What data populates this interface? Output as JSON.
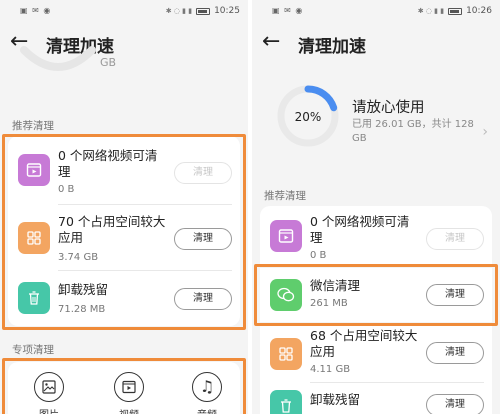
{
  "colors": {
    "accent": "#4a8df0",
    "highlight": "#ef8b3a",
    "purple": "#c77ad6",
    "orange_tile": "#f3a561",
    "teal": "#46c7a8",
    "green": "#5fcd6d"
  },
  "left": {
    "status": {
      "icons": "▣ ✉ ◉",
      "time": "10:25",
      "right_icons": "✱ ◌ ▮ ▮"
    },
    "title": "清理加速",
    "gb_partial": "GB",
    "section_recommend": "推荐清理",
    "items": [
      {
        "title_line1": "0 个网络视频可清",
        "title_line2": "理",
        "sub": "0 B",
        "button": "清理",
        "icon": "video-icon"
      },
      {
        "title_line1": "70 个占用空间较大",
        "title_line2": "应用",
        "sub": "3.74 GB",
        "button": "清理",
        "icon": "apps-grid-icon"
      },
      {
        "title_line1": "卸载残留",
        "title_line2": "",
        "sub": "71.28 MB",
        "button": "清理",
        "icon": "trash-icon"
      }
    ],
    "section_special": "专项清理",
    "special_items": [
      {
        "label": "图片",
        "icon": "image-icon"
      },
      {
        "label": "视频",
        "icon": "video-icon"
      },
      {
        "label": "音频",
        "icon": "music-note-icon"
      }
    ]
  },
  "right": {
    "status": {
      "icons": "▣ ✉ ◉",
      "time": "10:26",
      "right_icons": "✱ ◌ ▮ ▮"
    },
    "title": "清理加速",
    "storage": {
      "percent_label": "20%",
      "percent": 20,
      "headline": "请放心使用",
      "used": "已用 26.01 GB，共计 128",
      "used_line2": "GB"
    },
    "section_recommend": "推荐清理",
    "items": [
      {
        "title_line1": "0 个网络视频可清",
        "title_line2": "理",
        "sub": "0 B",
        "button": "清理",
        "icon": "video-icon"
      },
      {
        "title_line1": "微信清理",
        "title_line2": "",
        "sub": "261 MB",
        "button": "清理",
        "icon": "wechat-icon"
      },
      {
        "title_line1": "68 个占用空间较大",
        "title_line2": "应用",
        "sub": "4.11 GB",
        "button": "清理",
        "icon": "apps-grid-icon"
      },
      {
        "title_line1": "卸载残留",
        "title_line2": "",
        "sub": "",
        "button": "清理",
        "icon": "trash-icon"
      }
    ]
  }
}
